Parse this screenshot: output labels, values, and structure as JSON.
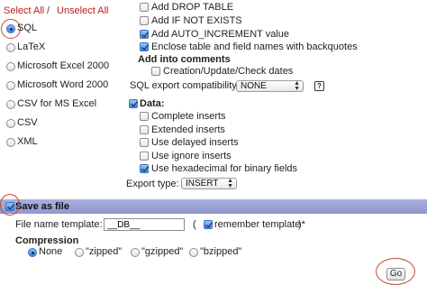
{
  "select_links": {
    "select_all": "Select All",
    "separator": "/",
    "unselect_all": "Unselect All"
  },
  "formats": [
    {
      "label": "SQL",
      "selected": true
    },
    {
      "label": "LaTeX",
      "selected": false
    },
    {
      "label": "Microsoft Excel 2000",
      "selected": false
    },
    {
      "label": "Microsoft Word 2000",
      "selected": false
    },
    {
      "label": "CSV for MS Excel",
      "selected": false
    },
    {
      "label": "CSV",
      "selected": false
    },
    {
      "label": "XML",
      "selected": false
    }
  ],
  "structure_options": {
    "add_drop_table": {
      "label": "Add DROP TABLE",
      "checked": false
    },
    "add_if_not_exists": {
      "label": "Add IF NOT EXISTS",
      "checked": false
    },
    "add_auto_increment": {
      "label": "Add AUTO_INCREMENT value",
      "checked": true
    },
    "enclose_backquotes": {
      "label": "Enclose table and field names with backquotes",
      "checked": true
    },
    "comments_heading": "Add into comments",
    "creation_dates": {
      "label": "Creation/Update/Check dates",
      "checked": false
    },
    "compatibility_label": "SQL export compatibility:",
    "compatibility_value": "NONE",
    "help_glyph": "?"
  },
  "data_options": {
    "data": {
      "label": "Data:",
      "checked": true
    },
    "complete_inserts": {
      "label": "Complete inserts",
      "checked": false
    },
    "extended_inserts": {
      "label": "Extended inserts",
      "checked": false
    },
    "delayed_inserts": {
      "label": "Use delayed inserts",
      "checked": false
    },
    "ignore_inserts": {
      "label": "Use ignore inserts",
      "checked": false
    },
    "hex_binary": {
      "label": "Use hexadecimal for binary fields",
      "checked": true
    },
    "export_type_label": "Export type:",
    "export_type_value": "INSERT"
  },
  "save_as_file": {
    "label": "Save as file",
    "checked": true,
    "template_label": "File name template:",
    "template_value": "__DB__",
    "paren_open": "(",
    "remember_label": "remember template",
    "paren_close": ")*",
    "remember_checked": true,
    "compression_label": "Compression",
    "compression_options": [
      {
        "label": "None",
        "selected": true
      },
      {
        "label": "\"zipped\"",
        "selected": false
      },
      {
        "label": "\"gzipped\"",
        "selected": false
      },
      {
        "label": "\"bzipped\"",
        "selected": false
      }
    ]
  },
  "go_button": "Go",
  "colors": {
    "link": "#b71c1c",
    "highlight_ring": "#c94a2a",
    "save_bar": "#a9b1df"
  }
}
